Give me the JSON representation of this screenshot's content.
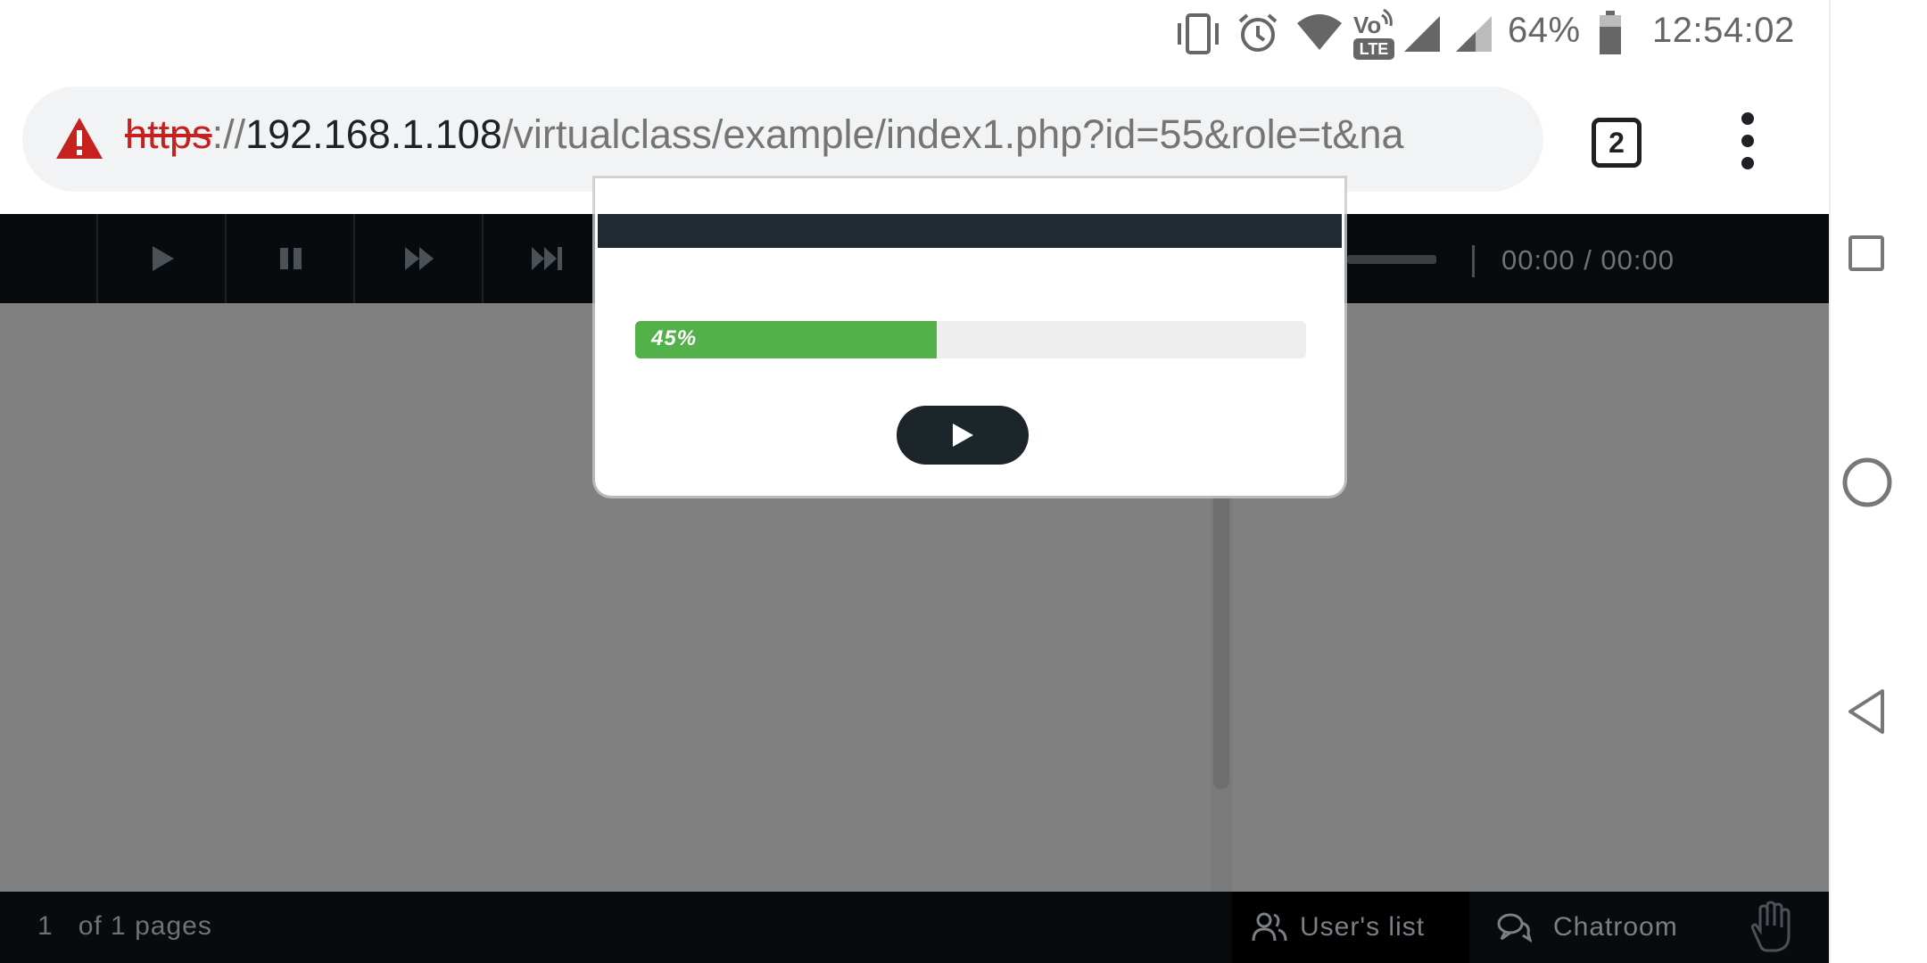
{
  "status_bar": {
    "battery_percent": "64%",
    "time": "12:54:02",
    "network_badge": "LTE",
    "icons": [
      "vibrate-icon",
      "alarm-icon",
      "wifi-icon",
      "volte-icon",
      "signal-icon",
      "signal-icon",
      "battery-icon"
    ]
  },
  "browser": {
    "url_scheme": "https",
    "url_separator": "://",
    "url_host": "192.168.1.108",
    "url_path": "/virtualclass/example/index1.php?id=55&role=t&na",
    "tab_count": "2",
    "security_icon": "warning-icon",
    "menu_icon": "more-vert-icon"
  },
  "player": {
    "controls": [
      "play-icon",
      "pause-icon",
      "fast-forward-icon",
      "skip-end-icon"
    ],
    "time": "00:00 / 00:00"
  },
  "modal": {
    "progress_percent": 45,
    "progress_label": "45%",
    "play_icon": "play-icon"
  },
  "footer": {
    "page_number": "1",
    "page_suffix": "of 1 pages",
    "users_tab": "User's list",
    "chat_tab": "Chatroom",
    "hand_icon": "raise-hand-icon"
  },
  "colors": {
    "accent_progress": "#53b14a",
    "warning": "#c5221f",
    "toolbar_bg": "#070b0d",
    "overlay_gray": "#808080"
  },
  "system_nav": [
    "recents-icon",
    "home-icon",
    "back-icon"
  ]
}
